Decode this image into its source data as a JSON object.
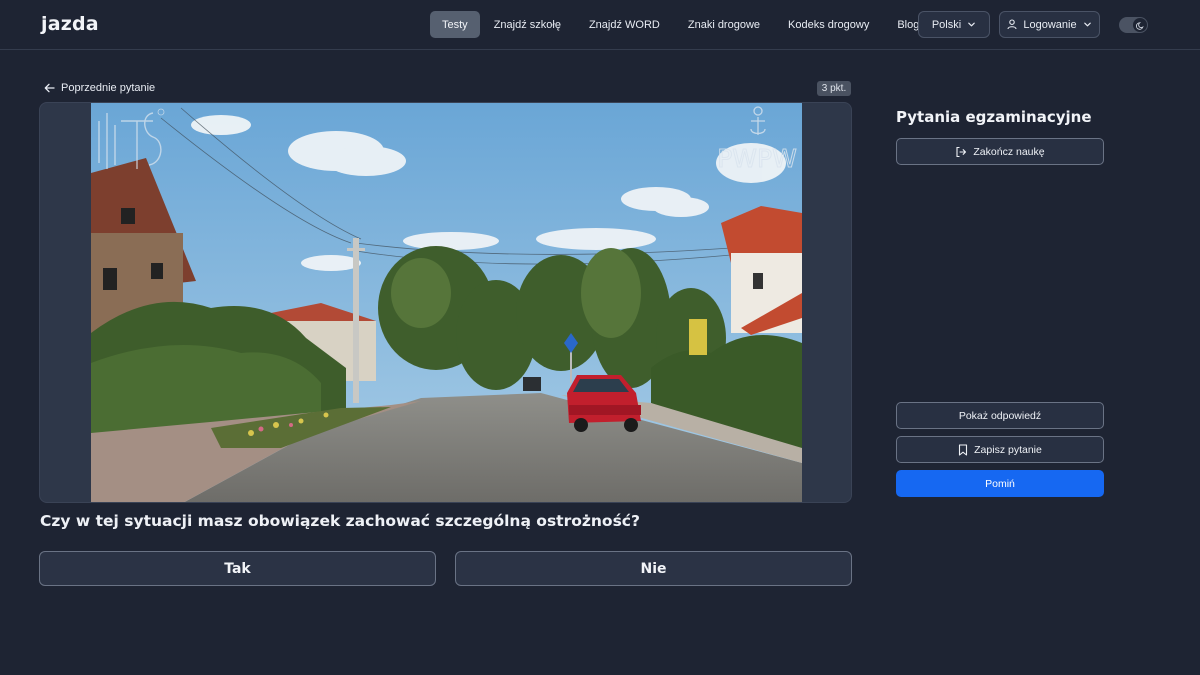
{
  "navbar": {
    "logo": "jazda",
    "links": [
      {
        "label": "Testy",
        "active": true
      },
      {
        "label": "Znajdź szkołę",
        "active": false
      },
      {
        "label": "Znajdź WORD",
        "active": false
      },
      {
        "label": "Znaki drogowe",
        "active": false
      },
      {
        "label": "Kodeks drogowy",
        "active": false
      },
      {
        "label": "Blog",
        "active": false
      }
    ],
    "language": "Polski",
    "login": "Logowanie"
  },
  "question_view": {
    "prev_label": "Poprzednie pytanie",
    "points": "3 pkt.",
    "watermark_right": "PWPW",
    "question_text": "Czy w tej sytuacji masz obowiązek zachować szczególną ostrożność?",
    "answers": [
      "Tak",
      "Nie"
    ]
  },
  "panel": {
    "title": "Pytania egzaminacyjne",
    "end_label": "Zakończ naukę",
    "show_label": "Pokaż odpowiedź",
    "save_label": "Zapisz pytanie",
    "skip_label": "Pomiń"
  },
  "colors": {
    "background": "#1e2433",
    "accent": "#1668f2",
    "active_tab": "#566070"
  },
  "icons": {
    "prev": "arrow-left-icon",
    "language": "chevron-down-icon",
    "login": "user-icon",
    "theme": "moon-icon",
    "end": "logout-icon",
    "save": "bookmark-icon"
  }
}
